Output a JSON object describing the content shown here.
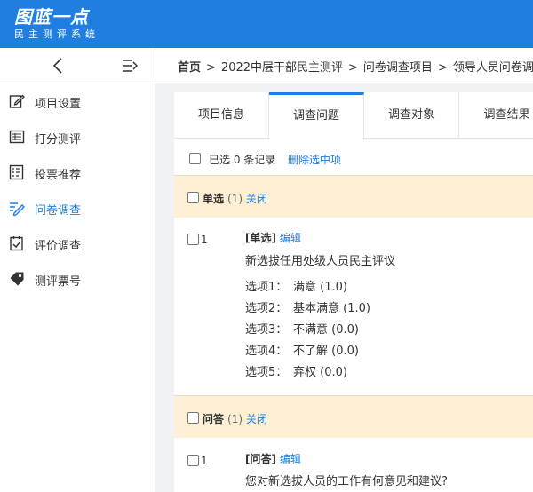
{
  "brand": {
    "title": "图蓝一点",
    "subtitle": "民主测评系统"
  },
  "sidebar": {
    "items": [
      {
        "label": "项目设置",
        "icon": "edit-icon"
      },
      {
        "label": "打分测评",
        "icon": "table-icon"
      },
      {
        "label": "投票推荐",
        "icon": "list-icon"
      },
      {
        "label": "问卷调查",
        "icon": "pen-icon",
        "active": true
      },
      {
        "label": "评价调查",
        "icon": "check-icon"
      },
      {
        "label": "测评票号",
        "icon": "tag-icon"
      }
    ]
  },
  "breadcrumb": {
    "home": "首页",
    "items": [
      "2022中层干部民主测评",
      "问卷调查项目",
      "领导人员问卷调"
    ],
    "separator": ">"
  },
  "tabs": [
    "项目信息",
    "调查问题",
    "调查对象",
    "调查结果"
  ],
  "active_tab": "调查问题",
  "selection": {
    "text": "已选 0 条记录",
    "delete_label": "删除选中项"
  },
  "groups": [
    {
      "type": "单选",
      "count": "(1)",
      "close": "关闭",
      "question": {
        "num": "1",
        "tag": "[单选]",
        "edit": "编辑",
        "text": "新选拔任用处级人员民主评议",
        "options": [
          {
            "label": "选项1：",
            "value": "满意 (1.0)"
          },
          {
            "label": "选项2：",
            "value": "基本满意 (1.0)"
          },
          {
            "label": "选项3：",
            "value": "不满意 (0.0)"
          },
          {
            "label": "选项4：",
            "value": "不了解 (0.0)"
          },
          {
            "label": "选项5：",
            "value": "弃权 (0.0)"
          }
        ]
      }
    },
    {
      "type": "问答",
      "count": "(1)",
      "close": "关闭",
      "question": {
        "num": "1",
        "tag": "[问答]",
        "edit": "编辑",
        "text": "您对新选拔人员的工作有何意见和建议?"
      }
    }
  ],
  "colors": {
    "primary": "#1f7ee0",
    "group_bg": "#fdf0d5",
    "page_bg": "#f0f2f5"
  }
}
